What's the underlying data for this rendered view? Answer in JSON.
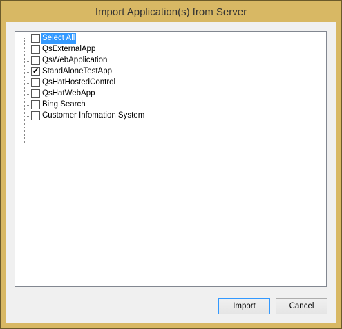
{
  "title": "Import Application(s) from Server",
  "items": [
    {
      "label": "Select All",
      "checked": false,
      "selected": true
    },
    {
      "label": "QsExternalApp",
      "checked": false
    },
    {
      "label": "QsWebApplication",
      "checked": false
    },
    {
      "label": "StandAloneTestApp",
      "checked": true
    },
    {
      "label": "QsHatHostedControl",
      "checked": false
    },
    {
      "label": "QsHatWebApp",
      "checked": false
    },
    {
      "label": "Bing Search",
      "checked": false
    },
    {
      "label": "Customer Infomation System",
      "checked": false
    }
  ],
  "buttons": {
    "import": "Import",
    "cancel": "Cancel"
  }
}
